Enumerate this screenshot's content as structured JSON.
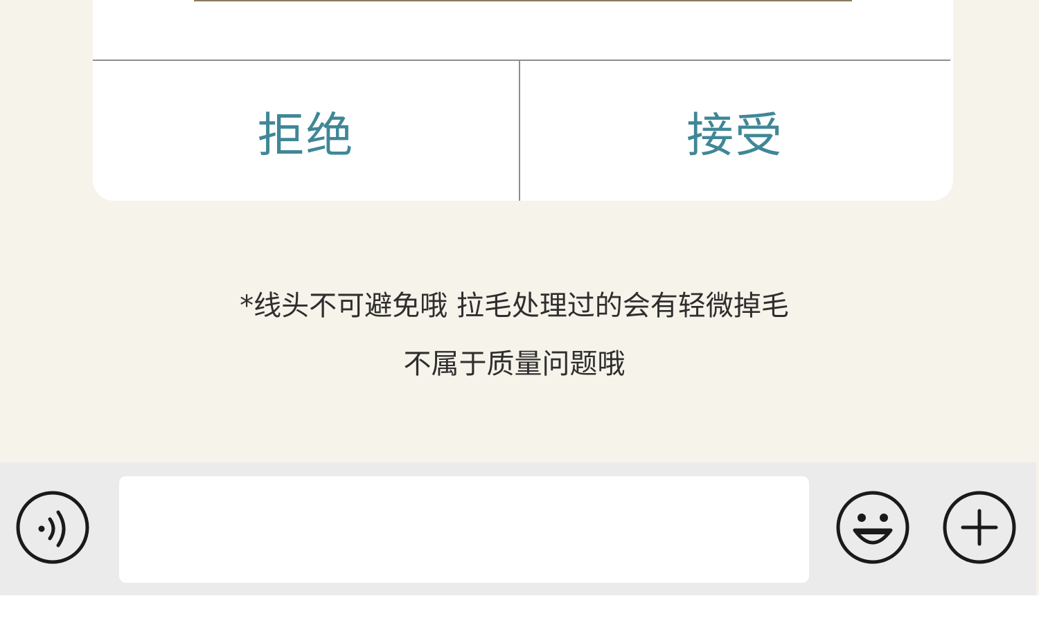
{
  "dialog": {
    "reject_label": "拒绝",
    "accept_label": "接受"
  },
  "notice": {
    "line1": "*线头不可避免哦 拉毛处理过的会有轻微掉毛",
    "line2": "不属于质量问题哦"
  },
  "input_bar": {
    "message_value": "",
    "icons": {
      "voice": "voice-icon",
      "emoji": "emoji-icon",
      "add": "plus-icon"
    }
  },
  "colors": {
    "page_background": "#f6f3ea",
    "dialog_button_text": "#3f8797",
    "input_bar_background": "#ebebeb"
  }
}
